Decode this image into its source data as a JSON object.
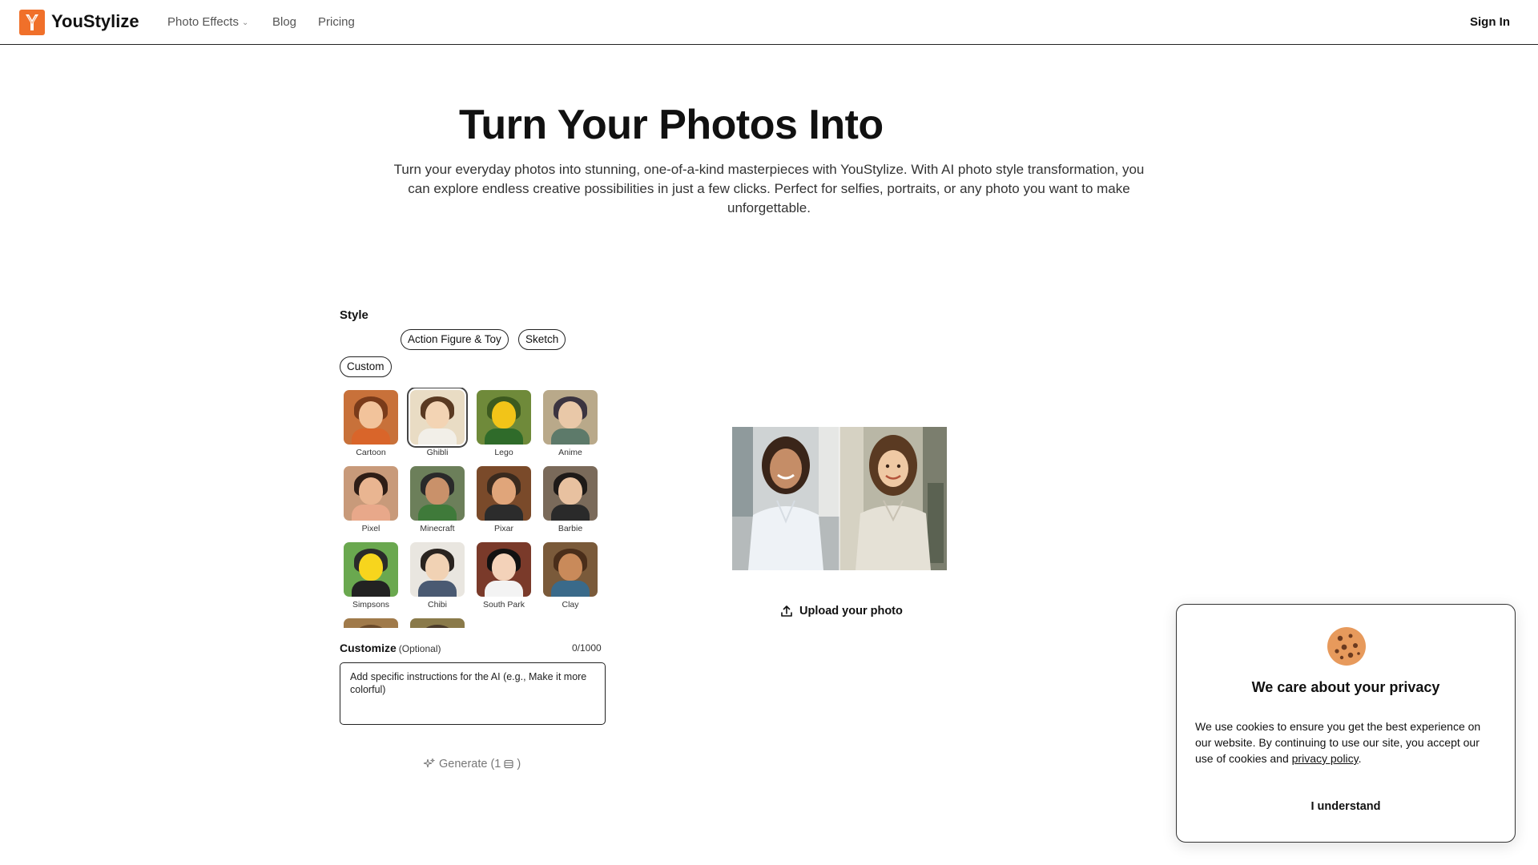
{
  "header": {
    "brand": "YouStylize",
    "nav": {
      "photo_effects": "Photo Effects",
      "blog": "Blog",
      "pricing": "Pricing"
    },
    "sign_in": "Sign In"
  },
  "hero": {
    "title": "Turn Your Photos Into",
    "subtitle": "Turn your everyday photos into stunning, one-of-a-kind masterpieces with YouStylize. With AI photo style transformation, you can explore endless creative possibilities in just a few clicks. Perfect for selfies, portraits, or any photo you want to make unforgettable."
  },
  "style_panel": {
    "label": "Style",
    "chips": [
      "Action Figure & Toy",
      "Sketch",
      "Custom"
    ],
    "selected_style": "Ghibli",
    "styles": [
      {
        "label": "Cartoon",
        "bg": "#c8713a",
        "skin": "#f2c39b",
        "hair": "#7a3b1a",
        "shirt": "#d9652a"
      },
      {
        "label": "Ghibli",
        "bg": "#e9dcc4",
        "skin": "#f3d4b4",
        "hair": "#5a3a22",
        "shirt": "#f2efe8"
      },
      {
        "label": "Lego",
        "bg": "#6f8a3a",
        "skin": "#f2c418",
        "hair": "#3d5a1f",
        "shirt": "#2f6b2a"
      },
      {
        "label": "Anime",
        "bg": "#b9a98a",
        "skin": "#e9c8a8",
        "hair": "#3b3440",
        "shirt": "#5d7a6a"
      },
      {
        "label": "Pixel",
        "bg": "#c89a7a",
        "skin": "#e9b591",
        "hair": "#2e1d16",
        "shirt": "#e8a88a"
      },
      {
        "label": "Minecraft",
        "bg": "#6c7f5a",
        "skin": "#c9916a",
        "hair": "#2a2a2a",
        "shirt": "#3f7a3a"
      },
      {
        "label": "Pixar",
        "bg": "#7a4a2a",
        "skin": "#e0a57a",
        "hair": "#3a2a1e",
        "shirt": "#2c2c2c"
      },
      {
        "label": "Barbie",
        "bg": "#7a6a5a",
        "skin": "#e8c1a0",
        "hair": "#1e1a18",
        "shirt": "#2a2a2a"
      },
      {
        "label": "Simpsons",
        "bg": "#6aa84f",
        "skin": "#f7d51d",
        "hair": "#2a2a2a",
        "shirt": "#222222"
      },
      {
        "label": "Chibi",
        "bg": "#e9e6e0",
        "skin": "#f1d2b4",
        "hair": "#2a2420",
        "shirt": "#4a5a72"
      },
      {
        "label": "South Park",
        "bg": "#7a3a2a",
        "skin": "#f3d2b9",
        "hair": "#111111",
        "shirt": "#f3f3f3"
      },
      {
        "label": "Clay",
        "bg": "#7a5a3a",
        "skin": "#c98a5a",
        "hair": "#4a2e1a",
        "shirt": "#3a6a8a"
      },
      {
        "label": "",
        "bg": "#a07a4a",
        "skin": "#e0b48a",
        "hair": "#6a4a2a",
        "shirt": "#8a6a4a"
      },
      {
        "label": "",
        "bg": "#8a7a4a",
        "skin": "#d9b08a",
        "hair": "#4a3a2a",
        "shirt": "#6a5a3a"
      }
    ]
  },
  "customize": {
    "label": "Customize",
    "optional": "(Optional)",
    "counter": "0/1000",
    "placeholder": "Add specific instructions for the AI (e.g., Make it more colorful)"
  },
  "generate": {
    "label": "Generate",
    "cost": "(1",
    "cost_close": ")"
  },
  "preview": {
    "upload_label": "Upload your photo"
  },
  "cookie": {
    "title": "We care about your privacy",
    "text_before": "We use cookies to ensure you get the best experience on our website. By continuing to use our site, you accept our use of cookies and ",
    "link": "privacy policy",
    "text_after": ".",
    "button": "I understand"
  },
  "colors": {
    "brand": "#f0702a",
    "text": "#111111",
    "muted": "#777777"
  }
}
